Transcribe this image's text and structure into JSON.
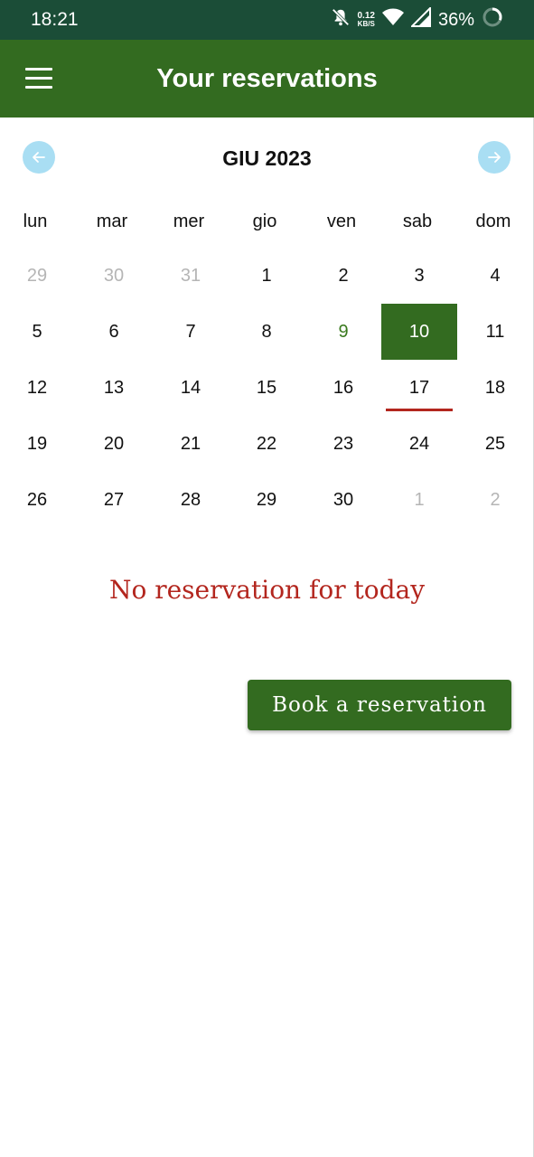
{
  "status_bar": {
    "time": "18:21",
    "net_speed_value": "0.12",
    "net_speed_unit": "KB/S",
    "battery": "36%",
    "icons": [
      "bell-off-icon",
      "wifi-icon",
      "signal-icon",
      "battery-icon"
    ]
  },
  "app_bar": {
    "title": "Your reservations",
    "menu_icon": "hamburger-menu-icon",
    "color": "#336b20"
  },
  "calendar": {
    "month_label": "GIU 2023",
    "prev_icon": "arrow-left-icon",
    "next_icon": "arrow-right-icon",
    "weekdays": [
      "lun",
      "mar",
      "mer",
      "gio",
      "ven",
      "sab",
      "dom"
    ],
    "weeks": [
      [
        {
          "d": "29",
          "other": true
        },
        {
          "d": "30",
          "other": true
        },
        {
          "d": "31",
          "other": true
        },
        {
          "d": "1"
        },
        {
          "d": "2"
        },
        {
          "d": "3"
        },
        {
          "d": "4"
        }
      ],
      [
        {
          "d": "5"
        },
        {
          "d": "6"
        },
        {
          "d": "7"
        },
        {
          "d": "8"
        },
        {
          "d": "9",
          "today": true
        },
        {
          "d": "10",
          "selected": true
        },
        {
          "d": "11"
        }
      ],
      [
        {
          "d": "12"
        },
        {
          "d": "13"
        },
        {
          "d": "14"
        },
        {
          "d": "15"
        },
        {
          "d": "16"
        },
        {
          "d": "17",
          "underlined": true
        },
        {
          "d": "18"
        }
      ],
      [
        {
          "d": "19"
        },
        {
          "d": "20"
        },
        {
          "d": "21"
        },
        {
          "d": "22"
        },
        {
          "d": "23"
        },
        {
          "d": "24"
        },
        {
          "d": "25"
        }
      ],
      [
        {
          "d": "26"
        },
        {
          "d": "27"
        },
        {
          "d": "28"
        },
        {
          "d": "29"
        },
        {
          "d": "30"
        },
        {
          "d": "1",
          "other": true
        },
        {
          "d": "2",
          "other": true
        }
      ]
    ],
    "colors": {
      "selected": "#336b20",
      "today": "#3a7a1e",
      "underline": "#b3261e",
      "nav_button": "#a9def3"
    }
  },
  "message": {
    "text": "No reservation for today",
    "color": "#b3261e"
  },
  "book_button": {
    "label": "Book a reservation"
  }
}
